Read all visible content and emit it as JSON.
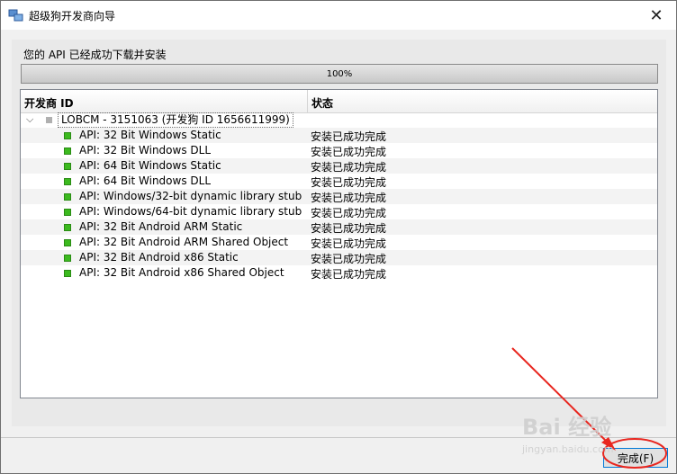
{
  "window": {
    "title": "超级狗开发商向导",
    "close_symbol": "✕"
  },
  "status": {
    "message": "您的 API 已经成功下载并安装",
    "progress_value": 1.0,
    "progress_text": "100%"
  },
  "tree": {
    "columns": [
      "开发商 ID",
      "状态"
    ],
    "root": {
      "label": "LOBCM - 3151063 (开发狗 ID 1656611999)",
      "status": ""
    },
    "items": [
      {
        "label": "API:  32 Bit Windows Static",
        "status": "安装已成功完成"
      },
      {
        "label": "API:  32 Bit Windows DLL",
        "status": "安装已成功完成"
      },
      {
        "label": "API:  64 Bit Windows Static",
        "status": "安装已成功完成"
      },
      {
        "label": "API:  64 Bit Windows DLL",
        "status": "安装已成功完成"
      },
      {
        "label": "API:  Windows/32-bit dynamic library stub",
        "status": "安装已成功完成"
      },
      {
        "label": "API:  Windows/64-bit dynamic library stub",
        "status": "安装已成功完成"
      },
      {
        "label": "API:  32 Bit Android ARM Static",
        "status": "安装已成功完成"
      },
      {
        "label": "API:  32 Bit Android ARM Shared Object",
        "status": "安装已成功完成"
      },
      {
        "label": "API:  32 Bit Android x86 Static",
        "status": "安装已成功完成"
      },
      {
        "label": "API:  32 Bit Android x86 Shared Object",
        "status": "安装已成功完成"
      }
    ]
  },
  "footer": {
    "finish_label": "完成(F)"
  },
  "watermark": {
    "logo": "Bai 经验",
    "url": "jingyan.baidu.com"
  },
  "colors": {
    "installed": "#3cba1f",
    "annotation": "#e8261f",
    "accent": "#0078d7"
  }
}
